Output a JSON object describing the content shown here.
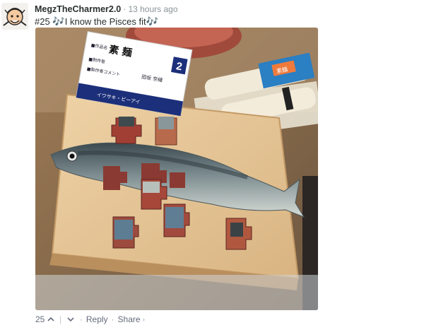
{
  "comment": {
    "author": "MegzTheCharmer2.0",
    "separator": "·",
    "time": "13 hours ago",
    "text_prefix": "#25 ",
    "note_glyph": "🎶",
    "text_body": "I know the Pisces fit",
    "upvotes": "25",
    "upvote_icon": "chevron-up-icon",
    "downvote_icon": "chevron-down-icon",
    "vote_separator": "|",
    "reply_label": "Reply",
    "share_label": "Share",
    "share_arrow": "›",
    "dot": "·"
  },
  "photo": {
    "sign_title": "素 麺",
    "sign_number": "2",
    "sign_line1": "■作品名",
    "sign_line2": "■制作者",
    "sign_line3": "■製作者コメント",
    "sign_maker": "田坂 奈緒",
    "sign_company": "イワサキ・ビーアイ",
    "noodle_label": "素麺"
  }
}
